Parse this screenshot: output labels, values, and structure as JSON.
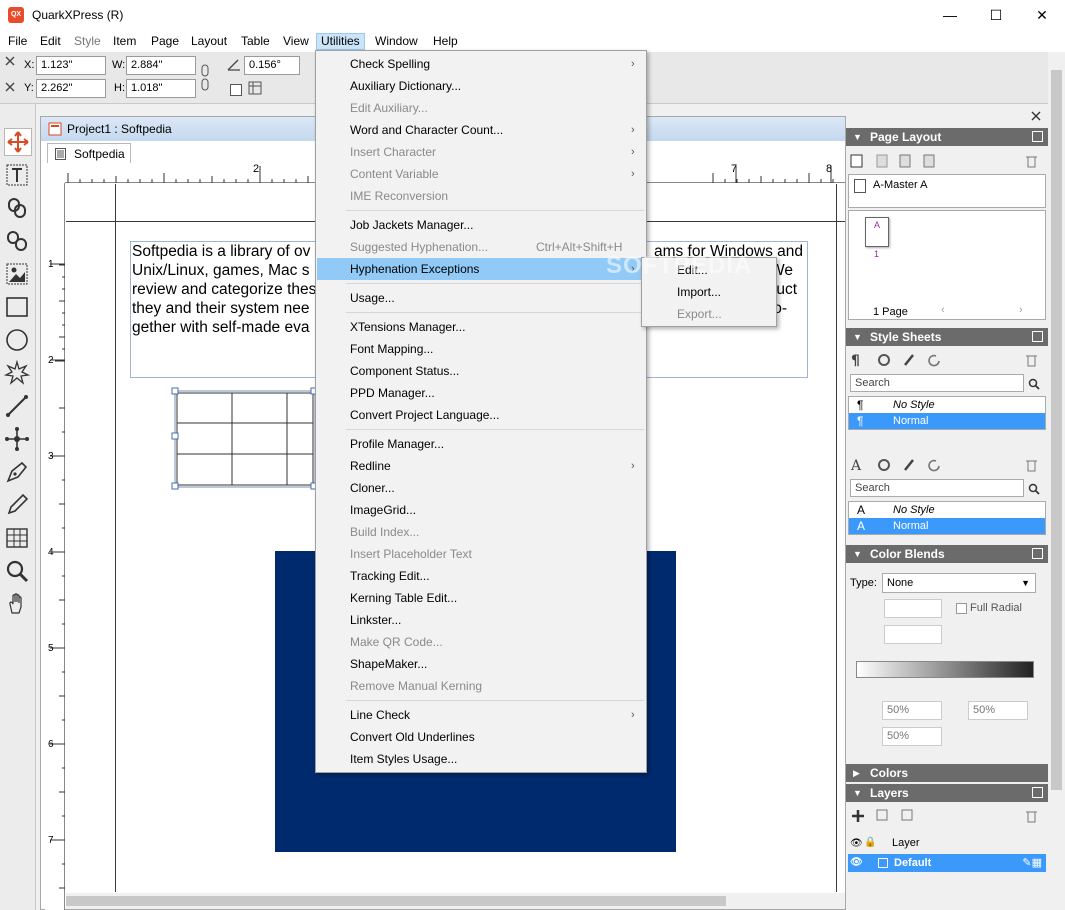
{
  "window": {
    "title": "QuarkXPress (R)",
    "app_icon": "QX",
    "minimize": "—",
    "maximize": "☐",
    "close": "✕"
  },
  "menubar": [
    "File",
    "Edit",
    "Style",
    "Item",
    "Page",
    "Layout",
    "Table",
    "View",
    "Utilities",
    "Window",
    "Help"
  ],
  "measure": {
    "x_label": "X:",
    "x": "1.123\"",
    "y_label": "Y:",
    "y": "2.262\"",
    "w_label": "W:",
    "w": "2.884\"",
    "h_label": "H:",
    "h": "1.018\"",
    "angle": "0.156°"
  },
  "document": {
    "window_title": "Project1 : Softpedia",
    "tab": "Softpedia",
    "ruler_h": [
      "2",
      "7",
      "8"
    ],
    "ruler_v": [
      "1",
      "2",
      "3",
      "4",
      "5",
      "6",
      "7"
    ],
    "text_lines": [
      "Softpedia is a library of ov",
      "Unix/Linux, games, Mac s",
      "review and categorize thes",
      "they and their system nee",
      "gether with self-made eva"
    ],
    "text_right": [
      "ams for Windows and",
      "We",
      "luct",
      "o-"
    ],
    "image_box_color": "#002a6e"
  },
  "utilities_menu": [
    {
      "label": "Check Spelling",
      "arrow": true
    },
    {
      "label": "Auxiliary Dictionary..."
    },
    {
      "label": "Edit Auxiliary...",
      "disabled": true
    },
    {
      "label": "Word and Character Count...",
      "arrow": true
    },
    {
      "label": "Insert Character",
      "disabled": true,
      "arrow": true
    },
    {
      "label": "Content Variable",
      "disabled": true,
      "arrow": true
    },
    {
      "label": "IME Reconversion",
      "disabled": true
    },
    {
      "label": "Job Jackets Manager..."
    },
    {
      "label": "Suggested Hyphenation...",
      "disabled": true,
      "shortcut": "Ctrl+Alt+Shift+H"
    },
    {
      "label": "Hyphenation Exceptions",
      "highlighted": true,
      "arrow": true
    },
    {
      "label": "Usage..."
    },
    {
      "label": "XTensions Manager..."
    },
    {
      "label": "Font Mapping..."
    },
    {
      "label": "Component Status..."
    },
    {
      "label": "PPD Manager..."
    },
    {
      "label": "Convert Project Language..."
    },
    {
      "label": "Profile Manager..."
    },
    {
      "label": "Redline",
      "arrow": true
    },
    {
      "label": "Cloner..."
    },
    {
      "label": "ImageGrid..."
    },
    {
      "label": "Build Index...",
      "disabled": true
    },
    {
      "label": "Insert Placeholder Text",
      "disabled": true
    },
    {
      "label": "Tracking Edit..."
    },
    {
      "label": "Kerning Table Edit..."
    },
    {
      "label": "Linkster..."
    },
    {
      "label": "Make QR Code...",
      "disabled": true
    },
    {
      "label": "ShapeMaker..."
    },
    {
      "label": "Remove Manual Kerning",
      "disabled": true
    },
    {
      "label": "Line Check",
      "arrow": true
    },
    {
      "label": "Convert Old Underlines"
    },
    {
      "label": "Item Styles Usage..."
    }
  ],
  "submenu": [
    {
      "label": "Edit..."
    },
    {
      "label": "Import..."
    },
    {
      "label": "Export...",
      "disabled": true
    }
  ],
  "panels": {
    "page_layout": {
      "title": "Page Layout",
      "master": "A-Master A",
      "page_letter": "A",
      "page_number": "1",
      "footer": "1 Page"
    },
    "style_sheets": {
      "title": "Style Sheets",
      "search": "Search",
      "paragraph": [
        "No Style",
        "Normal"
      ],
      "character": [
        "No Style",
        "Normal"
      ]
    },
    "color_blends": {
      "title": "Color Blends",
      "type_label": "Type:",
      "type_value": "None",
      "full_radial": "Full Radial",
      "pct1": "50%",
      "pct2": "50%",
      "pct3": "50%"
    },
    "colors": {
      "title": "Colors"
    },
    "layers": {
      "title": "Layers",
      "header": "Layer",
      "row": "Default"
    }
  },
  "colors": {
    "accent": "#3b99fc",
    "menu_highlight": "#91c9f7",
    "panel_header": "#6b6b6b"
  },
  "watermark": "SOFTPEDIA"
}
